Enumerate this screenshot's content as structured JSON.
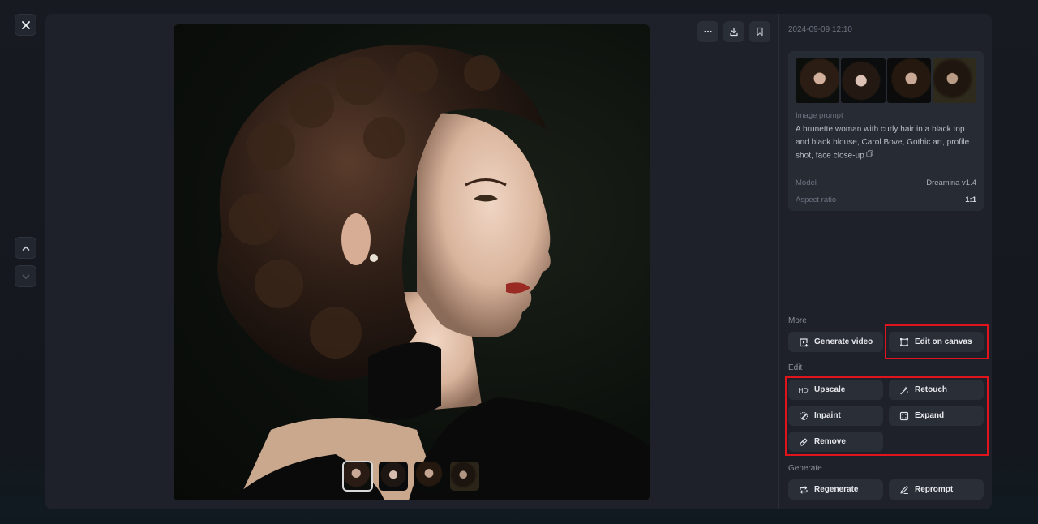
{
  "nav": {
    "close_icon": "close-icon",
    "prev_icon": "chevron-up-icon",
    "next_icon": "chevron-down-icon"
  },
  "viewer": {
    "main_image_alt": "Profile portrait of a brunette woman with curly hair in a black high-neck top",
    "top_actions": [
      {
        "name": "more-options-button",
        "icon": "ellipsis-icon"
      },
      {
        "name": "download-button",
        "icon": "download-icon"
      },
      {
        "name": "bookmark-button",
        "icon": "bookmark-icon"
      }
    ],
    "thumbnails": [
      {
        "label": "Variation 1",
        "selected": true
      },
      {
        "label": "Variation 2",
        "selected": false
      },
      {
        "label": "Variation 3",
        "selected": false
      },
      {
        "label": "Variation 4",
        "selected": false
      }
    ]
  },
  "side": {
    "timestamp": "2024-09-09 12:10",
    "info": {
      "prompt_label": "Image prompt",
      "prompt_text": "A brunette woman with curly hair in a black top and black blouse, Carol Bove, Gothic art, profile shot, face close-up",
      "copy_icon": "copy-icon",
      "model_label": "Model",
      "model_value": "Dreamina v1.4",
      "aspect_label": "Aspect ratio",
      "aspect_value": "1:1"
    },
    "sections": {
      "more": {
        "label": "More",
        "buttons": [
          {
            "label": "Generate video",
            "icon": "video-add-icon"
          },
          {
            "label": "Edit on canvas",
            "icon": "canvas-icon"
          }
        ]
      },
      "edit": {
        "label": "Edit",
        "buttons": [
          {
            "label": "Upscale",
            "icon": "hd-icon",
            "icon_text": "HD"
          },
          {
            "label": "Retouch",
            "icon": "magic-wand-icon"
          },
          {
            "label": "Inpaint",
            "icon": "brush-icon"
          },
          {
            "label": "Expand",
            "icon": "expand-icon"
          },
          {
            "label": "Remove",
            "icon": "eraser-icon"
          }
        ]
      },
      "generate": {
        "label": "Generate",
        "buttons": [
          {
            "label": "Regenerate",
            "icon": "refresh-icon"
          },
          {
            "label": "Reprompt",
            "icon": "pencil-icon"
          }
        ]
      }
    }
  },
  "colors": {
    "highlight": "#e0141a",
    "panel": "#1e2129",
    "button": "#2a2e37"
  }
}
